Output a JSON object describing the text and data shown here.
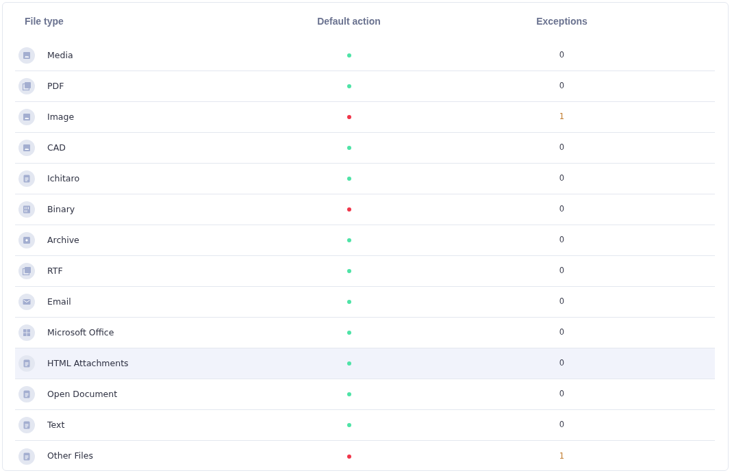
{
  "table": {
    "columns": [
      "File type",
      "Default action",
      "Exceptions"
    ],
    "rows": [
      {
        "kind": "image",
        "name": "Media",
        "color": "#4ee3a6",
        "exceptions": "0",
        "warning": false,
        "highlighted": false
      },
      {
        "kind": "pdf",
        "name": "PDF",
        "color": "#4ee3a6",
        "exceptions": "0",
        "warning": false,
        "highlighted": false
      },
      {
        "kind": "image",
        "name": "Image",
        "color": "#f0364a",
        "exceptions": "1",
        "warning": true,
        "highlighted": false
      },
      {
        "kind": "image",
        "name": "CAD",
        "color": "#4ee3a6",
        "exceptions": "0",
        "warning": false,
        "highlighted": false
      },
      {
        "kind": "doc",
        "name": "Ichitaro",
        "color": "#4ee3a6",
        "exceptions": "0",
        "warning": false,
        "highlighted": false
      },
      {
        "kind": "binary",
        "name": "Binary",
        "color": "#f0364a",
        "exceptions": "0",
        "warning": false,
        "highlighted": false
      },
      {
        "kind": "archive",
        "name": "Archive",
        "color": "#4ee3a6",
        "exceptions": "0",
        "warning": false,
        "highlighted": false
      },
      {
        "kind": "pdf",
        "name": "RTF",
        "color": "#4ee3a6",
        "exceptions": "0",
        "warning": false,
        "highlighted": false
      },
      {
        "kind": "email",
        "name": "Email",
        "color": "#4ee3a6",
        "exceptions": "0",
        "warning": false,
        "highlighted": false
      },
      {
        "kind": "grid",
        "name": "Microsoft Office",
        "color": "#4ee3a6",
        "exceptions": "0",
        "warning": false,
        "highlighted": false
      },
      {
        "kind": "doc",
        "name": "HTML Attachments",
        "color": "#4ee3a6",
        "exceptions": "0",
        "warning": false,
        "highlighted": true
      },
      {
        "kind": "doc",
        "name": "Open Document",
        "color": "#4ee3a6",
        "exceptions": "0",
        "warning": false,
        "highlighted": false
      },
      {
        "kind": "doc",
        "name": "Text",
        "color": "#4ee3a6",
        "exceptions": "0",
        "warning": false,
        "highlighted": false
      },
      {
        "kind": "doc",
        "name": "Other Files",
        "color": "#f0364a",
        "exceptions": "1",
        "warning": true,
        "highlighted": false
      }
    ]
  }
}
